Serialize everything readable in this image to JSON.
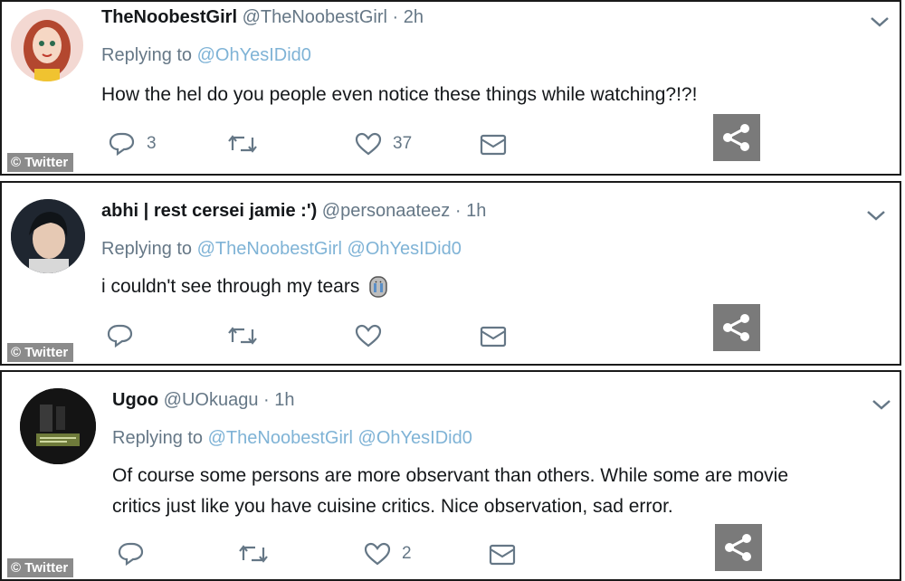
{
  "watermark": "© Twitter",
  "colors": {
    "mention": "#7fb3d6",
    "muted": "#657786",
    "share_bg": "#7a7a7a"
  },
  "tweets": [
    {
      "name": "TheNoobestGirl",
      "handle": "@TheNoobestGirl",
      "time": "· 2h",
      "replying_prefix": "Replying to",
      "mentions": "@OhYesIDid0",
      "text": "How the hel do you people even notice these things while watching?!?!",
      "reply_count": "3",
      "retweet_count": "",
      "like_count": "37"
    },
    {
      "name": "abhi | rest cersei jamie :')",
      "handle": "@personaateez",
      "time": "· 1h",
      "replying_prefix": "Replying to",
      "mentions": "@TheNoobestGirl @OhYesIDid0",
      "text": "i couldn't see through my tears",
      "emoji_icon": "crying-face-icon",
      "reply_count": "",
      "retweet_count": "",
      "like_count": ""
    },
    {
      "name": "Ugoo",
      "handle": "@UOkuagu",
      "time": "· 1h",
      "replying_prefix": "Replying to",
      "mentions": "@TheNoobestGirl @OhYesIDid0",
      "text_line1": "Of course some persons are more observant than others. While some are movie",
      "text_line2": "critics just like you have cuisine critics. Nice observation, sad error.",
      "reply_count": "",
      "retweet_count": "",
      "like_count": "2"
    }
  ]
}
